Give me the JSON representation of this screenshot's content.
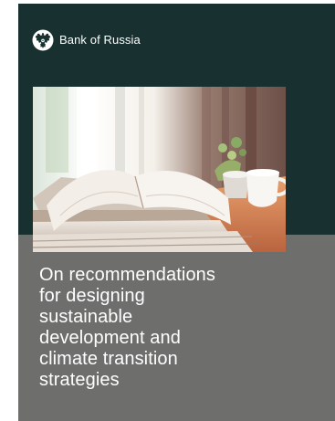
{
  "cover": {
    "brand_name": "Bank of Russia",
    "title_lines": [
      "On recommendations",
      "for designing",
      "sustainable",
      "development and",
      "climate transition",
      "strategies"
    ],
    "colors": {
      "top_band": "#183130",
      "bottom_band": "#6e6e6d",
      "text": "#ffffff"
    },
    "icons": {
      "brand_emblem": "double-headed-eagle-icon"
    },
    "image_subject": "open books on a table beside a cup and a potted plant"
  }
}
